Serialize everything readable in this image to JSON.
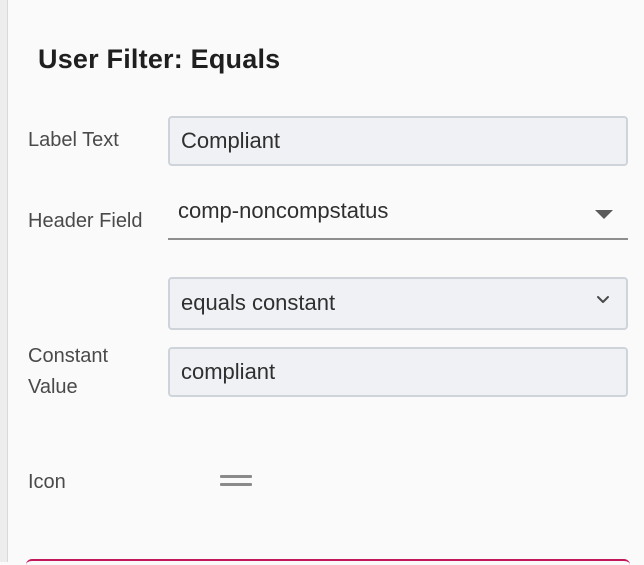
{
  "dialog": {
    "title": "User Filter: Equals"
  },
  "fields": {
    "label_text": {
      "label": "Label Text",
      "value": "Compliant"
    },
    "header_field": {
      "label": "Header Field",
      "value": "comp-noncompstatus",
      "icon": "triangle-down-icon"
    },
    "comparison": {
      "value": "equals constant",
      "icon": "chevron-down-icon"
    },
    "constant_value": {
      "label_line1": "Constant",
      "label_line2": "Value",
      "value": "compliant"
    },
    "icon": {
      "label": "Icon",
      "icon": "drag-handle-icon"
    }
  },
  "colors": {
    "accent": "#c2185b",
    "field_background": "#eff1f4",
    "field_border": "#cfd3da"
  }
}
